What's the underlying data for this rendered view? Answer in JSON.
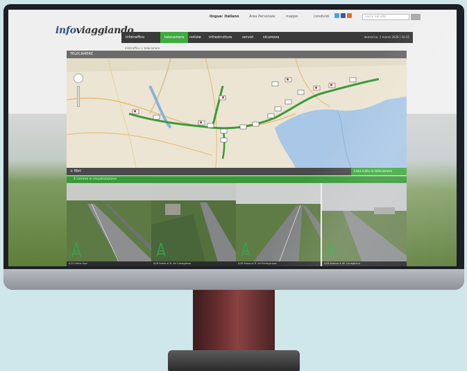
{
  "header": {
    "language": "lingua: italiano",
    "personal_area": "Area Personale",
    "map_link": "mappe",
    "share_label": "condividi",
    "search_placeholder": "cerca nel sito",
    "logo_info": "info",
    "logo_brand": "viaggiando"
  },
  "nav": {
    "items": [
      "infotraffico",
      "telecamere",
      "notizie",
      "infrastrutture",
      "servizi",
      "sicurezza"
    ],
    "active_index": 1,
    "date": "domenica, 1 marzo 2026 | 10:35"
  },
  "breadcrumb": "infotraffico > telecamere",
  "section_title": "TELECAMERE",
  "filter": {
    "label": "+ filtri",
    "list_button": "Lista tutte le telecamere"
  },
  "camera_bar": {
    "text": "4 camere in visualizzazione"
  },
  "cameras": [
    {
      "caption": "A23 Udine Sud"
    },
    {
      "caption": "A28 Sesto al R. dir Conegliano"
    },
    {
      "caption": "A28 Sesto al R. dir Portogruaro"
    },
    {
      "caption": "A28 Azzano X dir Conegliano"
    }
  ],
  "colors": {
    "accent_green": "#3faa3f",
    "nav_dark": "#3a3a3a",
    "logo_blue": "#2f4f85",
    "sea": "#a9c7e6",
    "route": "#3a9a3a"
  },
  "icons": [
    "zoom-control-icon",
    "camera-marker-icon",
    "antenna-icon",
    "facebook-icon",
    "twitter-icon",
    "rss-icon"
  ]
}
